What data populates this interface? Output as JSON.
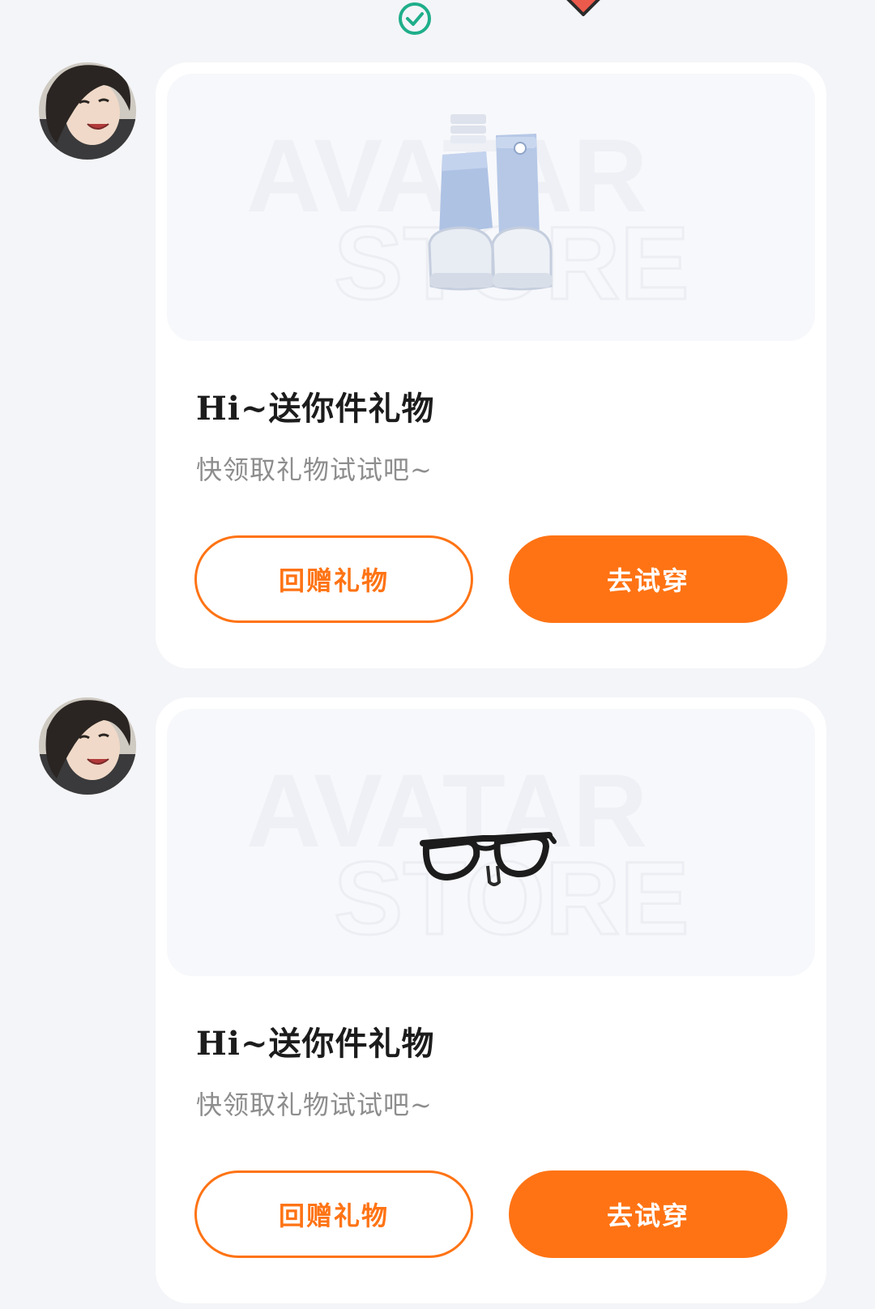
{
  "colors": {
    "accent": "#ff7314",
    "check": "#1fae8a",
    "background": "#f4f5f8",
    "card": "#ffffff"
  },
  "top": {
    "status_icon": "check-circle-icon"
  },
  "messages": [
    {
      "avatar": "user-avatar",
      "product_icon": "sneakers-with-socks-icon",
      "watermark": {
        "line1": "AVATAR",
        "line2": "STORE"
      },
      "title": "Hi~送你件礼物",
      "subtitle": "快领取礼物试试吧~",
      "return_gift_label": "回赠礼物",
      "try_on_label": "去试穿"
    },
    {
      "avatar": "user-avatar",
      "product_icon": "glasses-icon",
      "watermark": {
        "line1": "AVATAR",
        "line2": "STORE"
      },
      "title": "Hi~送你件礼物",
      "subtitle": "快领取礼物试试吧~",
      "return_gift_label": "回赠礼物",
      "try_on_label": "去试穿"
    }
  ]
}
